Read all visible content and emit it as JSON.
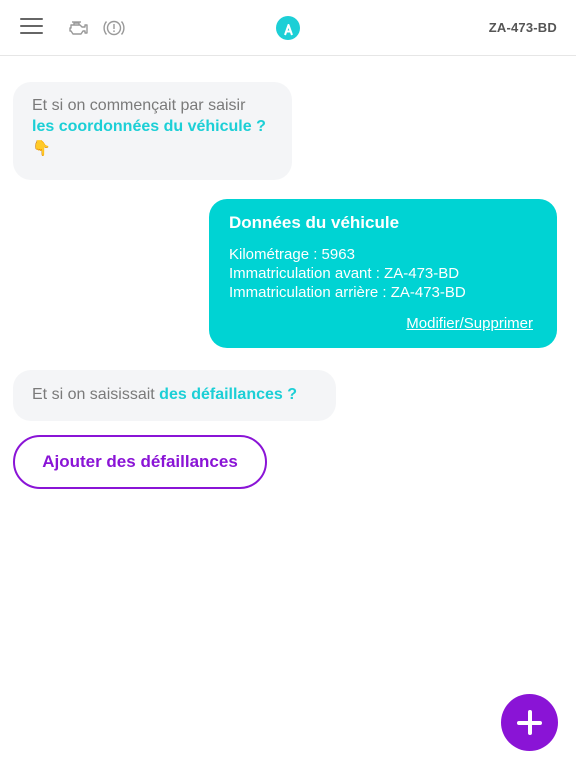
{
  "header": {
    "menu_icon": "hamburger-menu-icon",
    "engine_icon": "engine-icon",
    "brake_icon": "brake-warning-icon",
    "logo_icon": "app-logo-icon",
    "plate": "ZA-473-BD"
  },
  "chat": {
    "message1": {
      "text": "Et si on commençait par saisir",
      "highlight": "les coordonnées du véhicule ?",
      "emoji": "👇"
    },
    "vehicle_card": {
      "title": "Données du véhicule",
      "mileage": "Kilométrage : 5963",
      "front_plate": "Immatriculation avant : ZA-473-BD",
      "rear_plate": "Immatriculation arrière : ZA-473-BD",
      "edit_link": "Modifier/Supprimer"
    },
    "message2": {
      "text": "Et si on saisissait",
      "highlight": "des défaillances ?"
    }
  },
  "actions": {
    "add_defects": "Ajouter des défaillances",
    "fab_icon": "plus-icon"
  },
  "colors": {
    "accent": "#1ccfd6",
    "card": "#00d3d3",
    "primary": "#8a14d6",
    "bubble_bg": "#f4f5f7"
  }
}
